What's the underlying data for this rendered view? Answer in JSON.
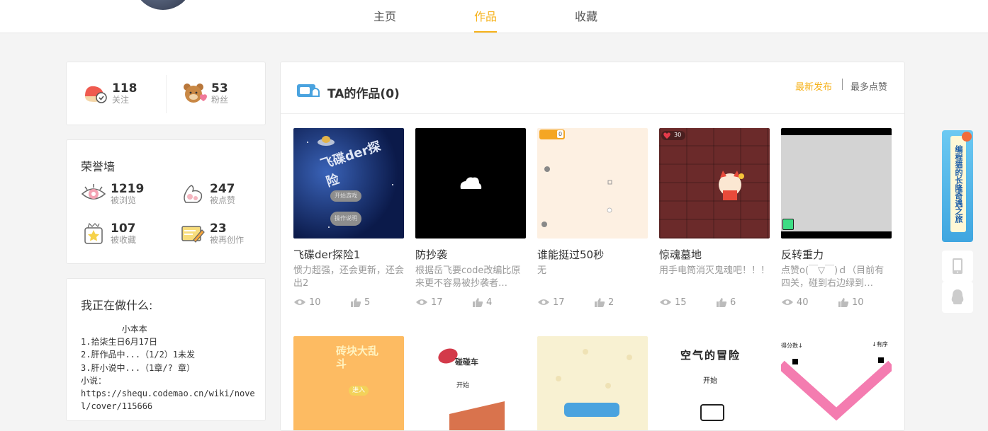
{
  "nav": {
    "tabs": [
      {
        "label": "主页"
      },
      {
        "label": "作品"
      },
      {
        "label": "收藏"
      }
    ]
  },
  "follow": {
    "following": {
      "count": "118",
      "label": "关注"
    },
    "fans": {
      "count": "53",
      "label": "粉丝"
    }
  },
  "honor": {
    "title": "荣誉墙",
    "views": {
      "count": "1219",
      "label": "被浏览"
    },
    "likes": {
      "count": "247",
      "label": "被点赞"
    },
    "collects": {
      "count": "107",
      "label": "被收藏"
    },
    "recreates": {
      "count": "23",
      "label": "被再创作"
    }
  },
  "doing": {
    "title": "我正在做什么:",
    "text": "        小本本\n1.拾柒生日6月17日\n2.肝作品中...（1/2）1未发\n3.肝小说中...（1章/? 章）\n小说：\nhttps://shequ.codemao.cn/wiki/nove\nl/cover/115666"
  },
  "works": {
    "title": "TA的作品(0)",
    "sort_latest": "最新发布",
    "sort_likes": "最多点赞",
    "items": [
      {
        "name": "飞碟der探险1",
        "desc": "惯力超强，还会更新，还会出2",
        "views": "10",
        "likes": "5",
        "thumb": {
          "title": "飞碟der探险",
          "btn1": "开始游戏",
          "btn2": "操作说明"
        }
      },
      {
        "name": "防抄袭",
        "desc": "根据岳飞要code改编比原来更不容易被抄袭者…",
        "views": "17",
        "likes": "4"
      },
      {
        "name": "谁能挺过50秒",
        "desc": "无",
        "views": "17",
        "likes": "2",
        "thumb": {
          "score": "0"
        }
      },
      {
        "name": "惊魂墓地",
        "desc": "用手电筒消灭鬼魂吧！！！",
        "views": "15",
        "likes": "6",
        "thumb": {
          "hp": "30"
        }
      },
      {
        "name": "反转重力",
        "desc": "点赞o(￣▽￣)ｄ（目前有四关，碰到右边绿到…",
        "views": "40",
        "likes": "10"
      }
    ],
    "row2": [
      {
        "title": "砖块大乱斗",
        "button": "进入"
      },
      {
        "title": "碰碰车",
        "button": "开始"
      },
      {},
      {
        "title": "空气的冒险",
        "subtitle": "开始"
      },
      {
        "left": "得分数↓",
        "right": "↓有序"
      }
    ]
  },
  "side": {
    "banner_text": "编程猫的长隆奇遇之旅"
  },
  "colors": {
    "accent": "#f6b21b"
  }
}
